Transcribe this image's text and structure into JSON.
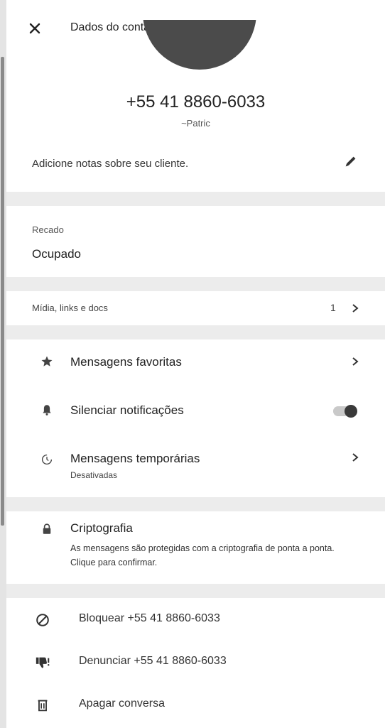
{
  "header": {
    "title": "Dados do contato"
  },
  "contact": {
    "phone": "+55 41 8860-6033",
    "pushname": "~Patric",
    "notes_label": "Adicione notas sobre seu cliente."
  },
  "about": {
    "label": "Recado",
    "value": "Ocupado"
  },
  "media": {
    "label": "Mídia, links e docs",
    "count": "1"
  },
  "settings": {
    "starred": "Mensagens favoritas",
    "mute": "Silenciar notificações",
    "mute_enabled": false,
    "disappearing": "Mensagens temporárias",
    "disappearing_status": "Desativadas"
  },
  "encryption": {
    "title": "Criptografia",
    "description": "As mensagens são protegidas com a criptografia de ponta a ponta. Clique para confirmar."
  },
  "actions": {
    "block": "Bloquear +55 41 8860-6033",
    "report": "Denunciar +55 41 8860-6033",
    "delete": "Apagar conversa"
  },
  "icons": {
    "close": "close-icon",
    "edit": "pencil-icon",
    "star": "star-icon",
    "mute": "bell-icon",
    "timer": "timer-icon",
    "lock": "lock-icon",
    "block": "block-icon",
    "report": "thumbs-down-icon",
    "delete": "trash-icon"
  },
  "colors": {
    "avatar": "#4b4b4b",
    "divider": "#ececec",
    "toggle_knob": "#3a3a3a"
  }
}
